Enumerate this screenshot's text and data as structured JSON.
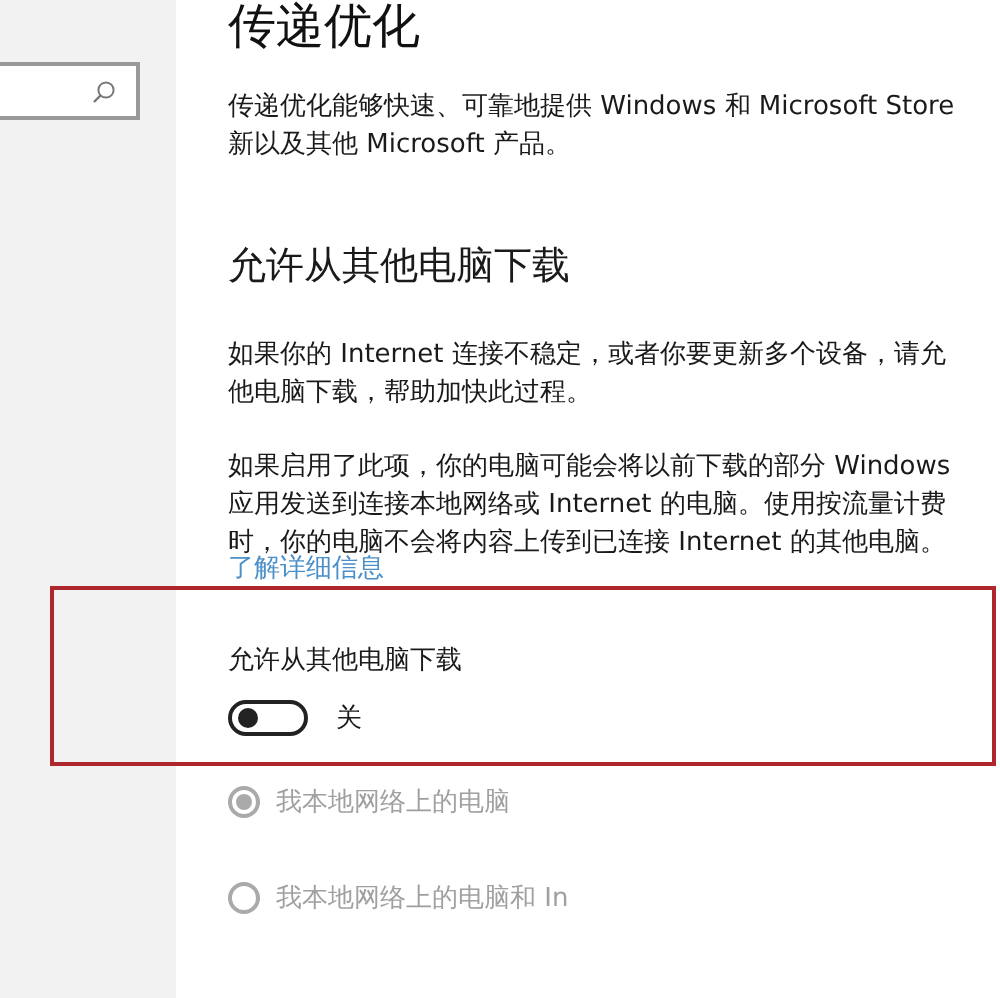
{
  "page": {
    "title": "传递优化",
    "intro_lines": [
      "传递优化能够快速、可靠地提供 Windows 和 Microsoft Store",
      "新以及其他 Microsoft 产品。"
    ],
    "section_title": "允许从其他电脑下载",
    "paragraphs": [
      [
        "如果你的 Internet 连接不稳定，或者你要更新多个设备，请允",
        "他电脑下载，帮助加快此过程。"
      ],
      [
        "如果启用了此项，你的电脑可能会将以前下载的部分 Windows",
        "应用发送到连接本地网络或 Internet 的电脑。使用按流量计费",
        "时，你的电脑不会将内容上传到已连接 Internet 的其他电脑。"
      ]
    ],
    "link": "了解详细信息",
    "toggle": {
      "label": "允许从其他电脑下载",
      "on": false,
      "state_text": "关",
      "highlighted": true
    },
    "radios": [
      {
        "label": "我本地网络上的电脑",
        "selected": true,
        "disabled": true
      },
      {
        "label": "我本地网络上的电脑和 In",
        "selected": false,
        "disabled": true
      }
    ]
  }
}
